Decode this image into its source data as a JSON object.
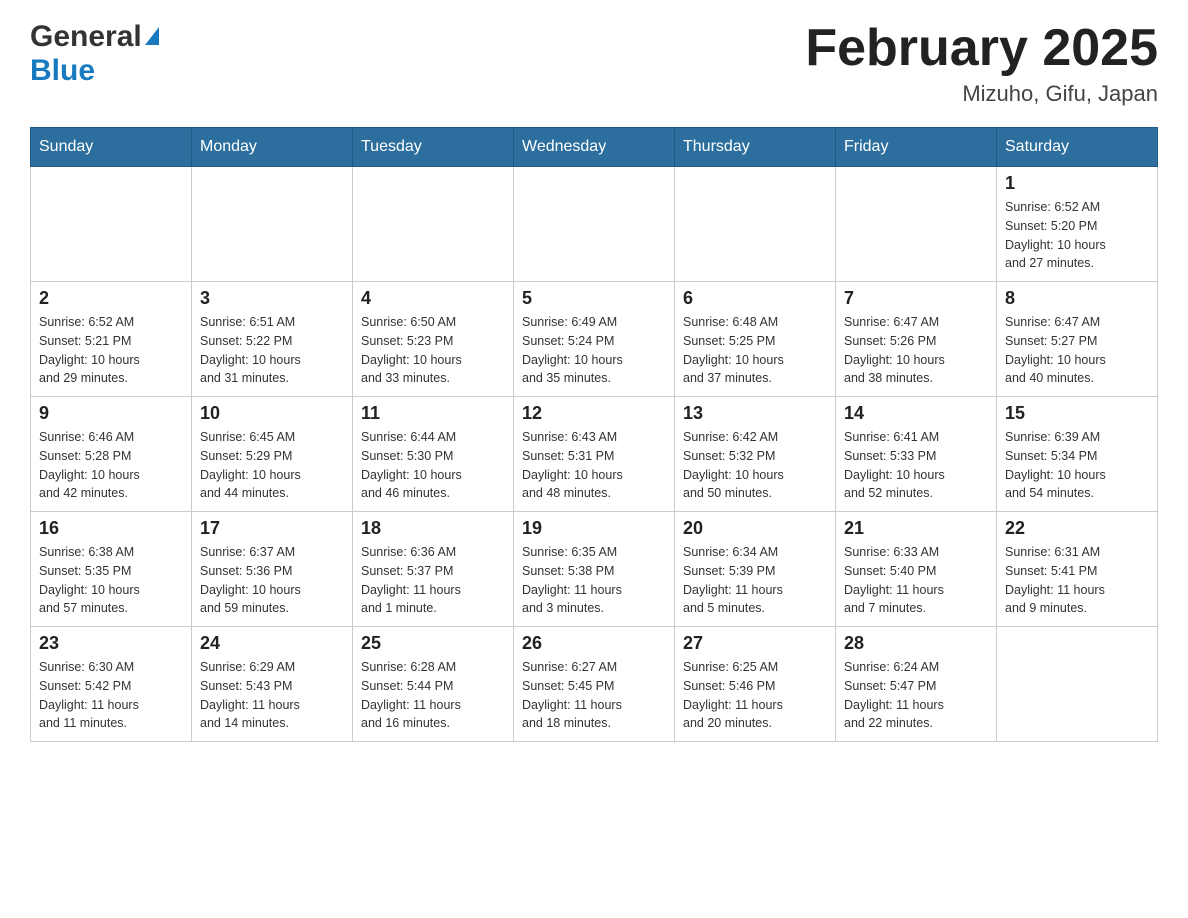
{
  "header": {
    "logo_general": "General",
    "logo_blue": "Blue",
    "month_title": "February 2025",
    "location": "Mizuho, Gifu, Japan"
  },
  "weekdays": [
    "Sunday",
    "Monday",
    "Tuesday",
    "Wednesday",
    "Thursday",
    "Friday",
    "Saturday"
  ],
  "weeks": [
    [
      {
        "day": "",
        "info": ""
      },
      {
        "day": "",
        "info": ""
      },
      {
        "day": "",
        "info": ""
      },
      {
        "day": "",
        "info": ""
      },
      {
        "day": "",
        "info": ""
      },
      {
        "day": "",
        "info": ""
      },
      {
        "day": "1",
        "info": "Sunrise: 6:52 AM\nSunset: 5:20 PM\nDaylight: 10 hours\nand 27 minutes."
      }
    ],
    [
      {
        "day": "2",
        "info": "Sunrise: 6:52 AM\nSunset: 5:21 PM\nDaylight: 10 hours\nand 29 minutes."
      },
      {
        "day": "3",
        "info": "Sunrise: 6:51 AM\nSunset: 5:22 PM\nDaylight: 10 hours\nand 31 minutes."
      },
      {
        "day": "4",
        "info": "Sunrise: 6:50 AM\nSunset: 5:23 PM\nDaylight: 10 hours\nand 33 minutes."
      },
      {
        "day": "5",
        "info": "Sunrise: 6:49 AM\nSunset: 5:24 PM\nDaylight: 10 hours\nand 35 minutes."
      },
      {
        "day": "6",
        "info": "Sunrise: 6:48 AM\nSunset: 5:25 PM\nDaylight: 10 hours\nand 37 minutes."
      },
      {
        "day": "7",
        "info": "Sunrise: 6:47 AM\nSunset: 5:26 PM\nDaylight: 10 hours\nand 38 minutes."
      },
      {
        "day": "8",
        "info": "Sunrise: 6:47 AM\nSunset: 5:27 PM\nDaylight: 10 hours\nand 40 minutes."
      }
    ],
    [
      {
        "day": "9",
        "info": "Sunrise: 6:46 AM\nSunset: 5:28 PM\nDaylight: 10 hours\nand 42 minutes."
      },
      {
        "day": "10",
        "info": "Sunrise: 6:45 AM\nSunset: 5:29 PM\nDaylight: 10 hours\nand 44 minutes."
      },
      {
        "day": "11",
        "info": "Sunrise: 6:44 AM\nSunset: 5:30 PM\nDaylight: 10 hours\nand 46 minutes."
      },
      {
        "day": "12",
        "info": "Sunrise: 6:43 AM\nSunset: 5:31 PM\nDaylight: 10 hours\nand 48 minutes."
      },
      {
        "day": "13",
        "info": "Sunrise: 6:42 AM\nSunset: 5:32 PM\nDaylight: 10 hours\nand 50 minutes."
      },
      {
        "day": "14",
        "info": "Sunrise: 6:41 AM\nSunset: 5:33 PM\nDaylight: 10 hours\nand 52 minutes."
      },
      {
        "day": "15",
        "info": "Sunrise: 6:39 AM\nSunset: 5:34 PM\nDaylight: 10 hours\nand 54 minutes."
      }
    ],
    [
      {
        "day": "16",
        "info": "Sunrise: 6:38 AM\nSunset: 5:35 PM\nDaylight: 10 hours\nand 57 minutes."
      },
      {
        "day": "17",
        "info": "Sunrise: 6:37 AM\nSunset: 5:36 PM\nDaylight: 10 hours\nand 59 minutes."
      },
      {
        "day": "18",
        "info": "Sunrise: 6:36 AM\nSunset: 5:37 PM\nDaylight: 11 hours\nand 1 minute."
      },
      {
        "day": "19",
        "info": "Sunrise: 6:35 AM\nSunset: 5:38 PM\nDaylight: 11 hours\nand 3 minutes."
      },
      {
        "day": "20",
        "info": "Sunrise: 6:34 AM\nSunset: 5:39 PM\nDaylight: 11 hours\nand 5 minutes."
      },
      {
        "day": "21",
        "info": "Sunrise: 6:33 AM\nSunset: 5:40 PM\nDaylight: 11 hours\nand 7 minutes."
      },
      {
        "day": "22",
        "info": "Sunrise: 6:31 AM\nSunset: 5:41 PM\nDaylight: 11 hours\nand 9 minutes."
      }
    ],
    [
      {
        "day": "23",
        "info": "Sunrise: 6:30 AM\nSunset: 5:42 PM\nDaylight: 11 hours\nand 11 minutes."
      },
      {
        "day": "24",
        "info": "Sunrise: 6:29 AM\nSunset: 5:43 PM\nDaylight: 11 hours\nand 14 minutes."
      },
      {
        "day": "25",
        "info": "Sunrise: 6:28 AM\nSunset: 5:44 PM\nDaylight: 11 hours\nand 16 minutes."
      },
      {
        "day": "26",
        "info": "Sunrise: 6:27 AM\nSunset: 5:45 PM\nDaylight: 11 hours\nand 18 minutes."
      },
      {
        "day": "27",
        "info": "Sunrise: 6:25 AM\nSunset: 5:46 PM\nDaylight: 11 hours\nand 20 minutes."
      },
      {
        "day": "28",
        "info": "Sunrise: 6:24 AM\nSunset: 5:47 PM\nDaylight: 11 hours\nand 22 minutes."
      },
      {
        "day": "",
        "info": ""
      }
    ]
  ]
}
